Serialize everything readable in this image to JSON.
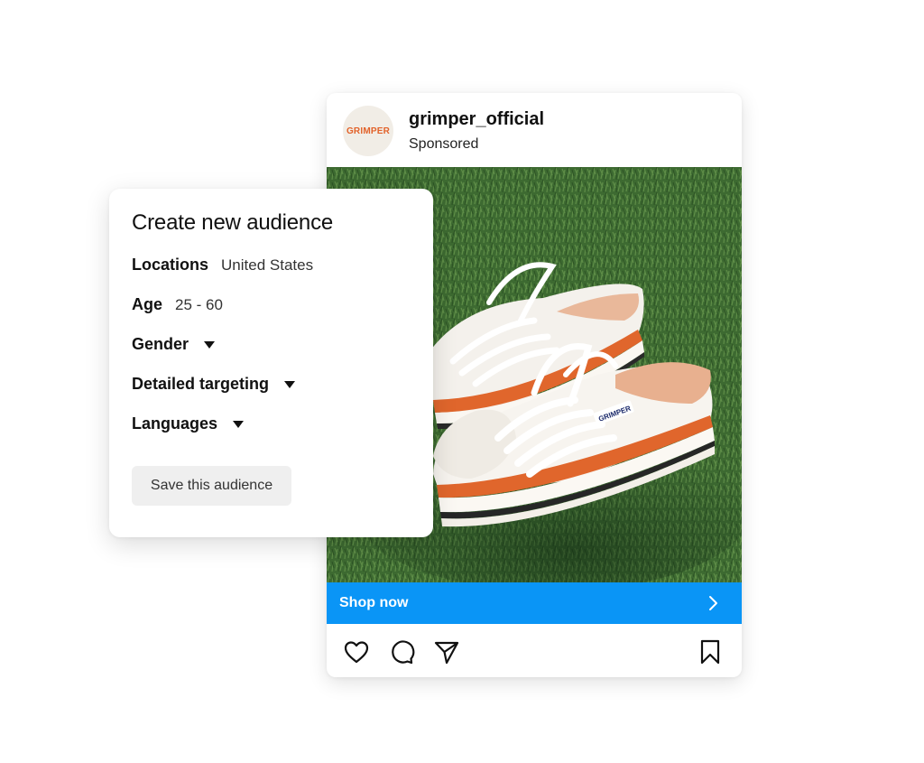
{
  "post": {
    "account_name": "grimper_official",
    "sponsored_label": "Sponsored",
    "avatar_logo_text": "GRIMPER",
    "shoe_tag_text": "GRIMPER",
    "cta_label": "Shop now",
    "icons": [
      "heart-icon",
      "comment-icon",
      "share-icon",
      "bookmark-icon",
      "chevron-right-icon"
    ]
  },
  "audience": {
    "title": "Create new audience",
    "locations_label": "Locations",
    "locations_value": "United States",
    "age_label": "Age",
    "age_value": "25 - 60",
    "gender_label": "Gender",
    "detailed_targeting_label": "Detailed targeting",
    "languages_label": "Languages",
    "save_label": "Save this audience"
  },
  "colors": {
    "cta_blue": "#0a95f6",
    "brand_orange": "#e2622a",
    "grass_green": "#3f6d33"
  }
}
